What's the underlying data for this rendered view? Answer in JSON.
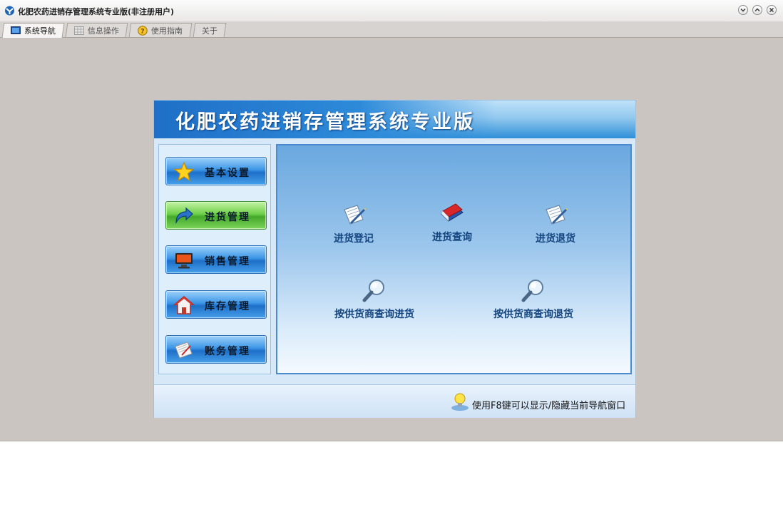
{
  "window": {
    "title": "化肥农药进销存管理系统专业版(非注册用户)",
    "controls": [
      "minimize",
      "maximize",
      "close"
    ]
  },
  "tabs": [
    {
      "label": "系统导航",
      "icon": "monitor-icon",
      "active": true
    },
    {
      "label": "信息操作",
      "icon": "grid-icon",
      "active": false
    },
    {
      "label": "使用指南",
      "icon": "help-icon",
      "active": false
    },
    {
      "label": "关于",
      "icon": "",
      "active": false
    }
  ],
  "banner": {
    "title": "化肥农药进销存管理系统专业版"
  },
  "sidebar": {
    "items": [
      {
        "label": "基本设置",
        "icon": "star-icon",
        "active": false
      },
      {
        "label": "进货管理",
        "icon": "arrow-icon",
        "active": true
      },
      {
        "label": "销售管理",
        "icon": "monitor-icon",
        "active": false
      },
      {
        "label": "库存管理",
        "icon": "house-icon",
        "active": false
      },
      {
        "label": "账务管理",
        "icon": "papers-icon",
        "active": false
      }
    ]
  },
  "functions": [
    {
      "label": "进货登记",
      "icon": "notebook-pen-icon"
    },
    {
      "label": "进货查询",
      "icon": "book-icon"
    },
    {
      "label": "进货退货",
      "icon": "notebook-pen-icon"
    },
    {
      "label": "按供货商查询进货",
      "icon": "magnifier-icon"
    },
    {
      "label": "按供货商查询退货",
      "icon": "magnifier-icon"
    }
  ],
  "footer": {
    "hint": "使用F8键可以显示/隐藏当前导航窗口",
    "icon": "lightbulb-icon"
  },
  "colors": {
    "background": "#cbc5c1",
    "accent": "#1e6fc8",
    "active_nav": "#44a82a"
  }
}
